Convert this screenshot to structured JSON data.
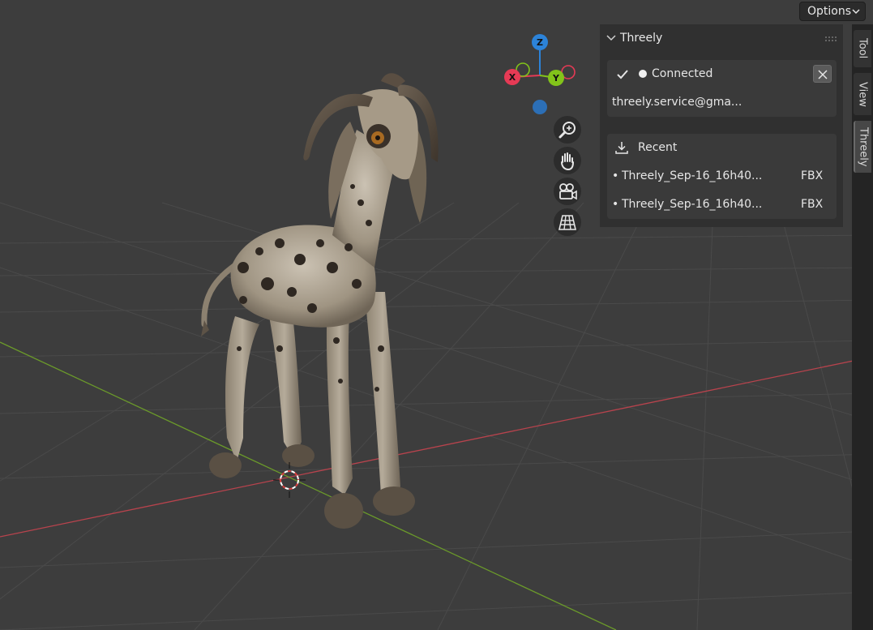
{
  "header": {
    "options_label": "Options"
  },
  "tabs": [
    {
      "label": "Tool",
      "active": false
    },
    {
      "label": "View",
      "active": false
    },
    {
      "label": "Threely",
      "active": true
    }
  ],
  "panel": {
    "title": "Threely",
    "connection": {
      "status": "Connected",
      "email": "threely.service@gma...",
      "status_color": "#f0f0f0"
    },
    "recent": {
      "title": "Recent",
      "items": [
        {
          "name": "Threely_Sep-16_16h40...",
          "format": "FBX"
        },
        {
          "name": "Threely_Sep-16_16h40...",
          "format": "FBX"
        }
      ]
    }
  },
  "gizmo": {
    "x_label": "X",
    "y_label": "Y",
    "z_label": "Z",
    "x_color": "#e63a55",
    "y_color": "#82c31a",
    "z_color": "#2c83d9"
  },
  "nav_buttons": [
    {
      "icon": "zoom-icon"
    },
    {
      "icon": "hand-pan-icon"
    },
    {
      "icon": "camera-icon"
    },
    {
      "icon": "grid-perspective-icon"
    }
  ],
  "colors": {
    "background": "#3d3d3d",
    "panel": "#303030",
    "box": "#3a3a3a"
  }
}
